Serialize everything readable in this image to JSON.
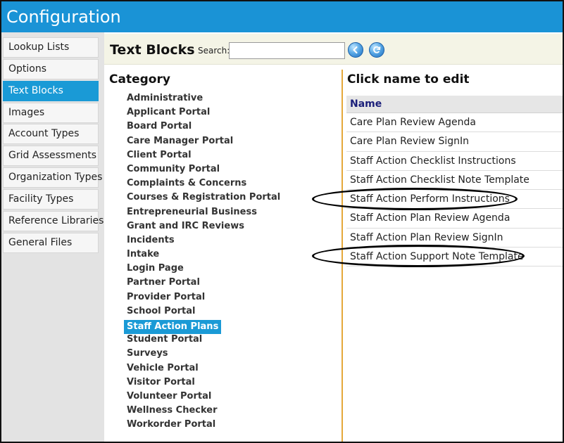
{
  "window": {
    "title": "Configuration"
  },
  "sidebar": {
    "items": [
      {
        "label": "Lookup Lists",
        "active": false
      },
      {
        "label": "Options",
        "active": false
      },
      {
        "label": "Text Blocks",
        "active": true
      },
      {
        "label": "Images",
        "active": false
      },
      {
        "label": "Account Types",
        "active": false
      },
      {
        "label": "Grid Assessments",
        "active": false
      },
      {
        "label": "Organization Types",
        "active": false
      },
      {
        "label": "Facility Types",
        "active": false
      },
      {
        "label": "Reference Libraries",
        "active": false
      },
      {
        "label": "General Files",
        "active": false
      }
    ]
  },
  "header": {
    "title": "Text Blocks",
    "search_label": "Search:",
    "search_value": "",
    "back_icon": "arrow-left-icon",
    "refresh_icon": "refresh-icon"
  },
  "category": {
    "title": "Category",
    "items": [
      "Administrative",
      "Applicant Portal",
      "Board Portal",
      "Care Manager Portal",
      "Client Portal",
      "Community Portal",
      "Complaints & Concerns",
      "Courses & Registration Portal",
      "Entrepreneurial Business",
      "Grant and IRC Reviews",
      "Incidents",
      "Intake",
      "Login Page",
      "Partner Portal",
      "Provider Portal",
      "School Portal",
      "Staff Action Plans",
      "Student Portal",
      "Surveys",
      "Vehicle Portal",
      "Visitor Portal",
      "Volunteer Portal",
      "Wellness Checker",
      "Workorder Portal"
    ],
    "selected": "Staff Action Plans"
  },
  "edit": {
    "title": "Click name to edit",
    "column_header": "Name",
    "rows": [
      "Care Plan Review Agenda",
      "Care Plan Review SignIn",
      "Staff Action Checklist Instructions",
      "Staff Action Checklist Note Template",
      "Staff Action Perform Instructions",
      "Staff Action Plan Review Agenda",
      "Staff Action Plan Review SignIn",
      "Staff Action Support Note Template"
    ],
    "circled_rows": [
      "Staff Action Perform Instructions",
      "Staff Action Support Note Template"
    ]
  },
  "colors": {
    "titlebar": "#1a93d6",
    "selection": "#1a9ad6",
    "divider": "#e5a83b",
    "header_bg": "#f4f4e6",
    "column_header_text": "#1b1f7a"
  }
}
